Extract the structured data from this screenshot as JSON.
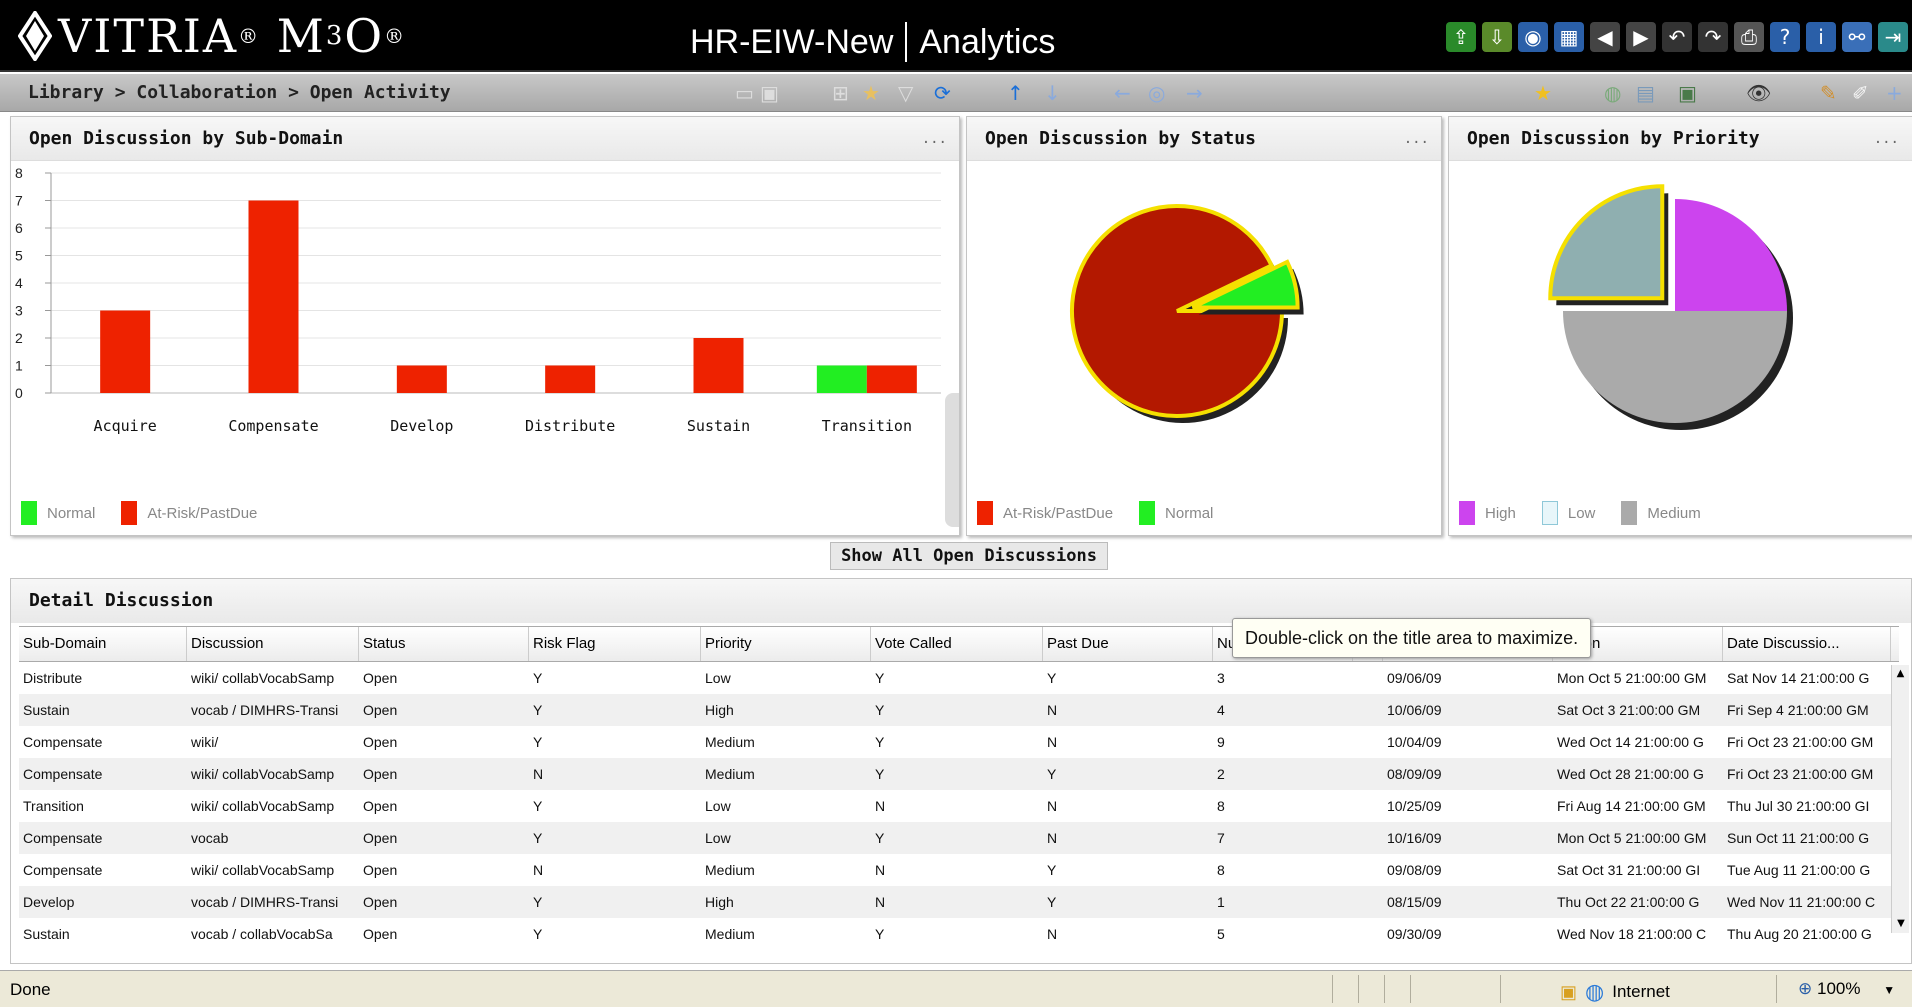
{
  "header": {
    "logo": "VITRIA",
    "logo_sup1": "®",
    "product": "M",
    "product_sub": "3",
    "product_end": "O",
    "logo_sup2": "®",
    "app_name": "HR-EIW-New",
    "section": "Analytics"
  },
  "breadcrumb": "Library > Collaboration > Open Activity",
  "subdomain_panel": {
    "title": "Open Discussion by Sub-Domain",
    "menu": "...",
    "legend": [
      "Normal",
      "At-Risk/PastDue"
    ]
  },
  "status_panel": {
    "title": "Open Discussion by Status",
    "menu": "...",
    "legend": [
      "At-Risk/PastDue",
      "Normal"
    ]
  },
  "priority_panel": {
    "title": "Open Discussion by Priority",
    "menu": "...",
    "legend": [
      "High",
      "Low",
      "Medium"
    ]
  },
  "show_all_label": "Show All Open Discussions",
  "detail": {
    "title": "Detail Discussion",
    "tooltip": "Double-click on the title area to maximize.",
    "columns": [
      "Sub-Domain",
      "Discussion",
      "Status",
      "Risk Flag",
      "Priority",
      "Vote Called",
      "Past Due",
      "Nu",
      "",
      "",
      "ussion",
      "Date Discussio..."
    ],
    "rows": [
      [
        "Distribute",
        "wiki/ collabVocabSamp",
        "Open",
        "Y",
        "Low",
        "Y",
        "Y",
        "3",
        "",
        "09/06/09",
        "Mon Oct 5 21:00:00 GM",
        "Sat Nov 14 21:00:00 G"
      ],
      [
        "Sustain",
        "vocab / DIMHRS-Transi",
        "Open",
        "Y",
        "High",
        "Y",
        "N",
        "4",
        "",
        "10/06/09",
        "Sat Oct 3 21:00:00 GM",
        "Fri Sep 4 21:00:00 GM"
      ],
      [
        "Compensate",
        "wiki/",
        "Open",
        "Y",
        "Medium",
        "Y",
        "N",
        "9",
        "",
        "10/04/09",
        "Wed Oct 14 21:00:00 G",
        "Fri Oct 23 21:00:00 GM"
      ],
      [
        "Compensate",
        "wiki/ collabVocabSamp",
        "Open",
        "N",
        "Medium",
        "Y",
        "Y",
        "2",
        "",
        "08/09/09",
        "Wed Oct 28 21:00:00 G",
        "Fri Oct 23 21:00:00 GM"
      ],
      [
        "Transition",
        "wiki/ collabVocabSamp",
        "Open",
        "Y",
        "Low",
        "N",
        "N",
        "8",
        "",
        "10/25/09",
        "Fri Aug 14 21:00:00 GM",
        "Thu Jul 30 21:00:00 GI"
      ],
      [
        "Compensate",
        "vocab",
        "Open",
        "Y",
        "Low",
        "Y",
        "N",
        "7",
        "",
        "10/16/09",
        "Mon Oct 5 21:00:00 GM",
        "Sun Oct 11 21:00:00 G"
      ],
      [
        "Compensate",
        "wiki/ collabVocabSamp",
        "Open",
        "N",
        "Medium",
        "N",
        "Y",
        "8",
        "",
        "09/08/09",
        "Sat Oct 31 21:00:00 GI",
        "Tue Aug 11 21:00:00 G"
      ],
      [
        "Develop",
        "vocab / DIMHRS-Transi",
        "Open",
        "Y",
        "High",
        "N",
        "Y",
        "1",
        "",
        "08/15/09",
        "Thu Oct 22 21:00:00 G",
        "Wed Nov 11 21:00:00 C"
      ],
      [
        "Sustain",
        "vocab / collabVocabSa",
        "Open",
        "Y",
        "Medium",
        "Y",
        "N",
        "5",
        "",
        "09/30/09",
        "Wed Nov 18 21:00:00 C",
        "Thu Aug 20 21:00:00 G"
      ]
    ]
  },
  "statusbar": {
    "status": "Done",
    "zone": "Internet",
    "zoom": "100%"
  },
  "colors": {
    "normal": "#22ee22",
    "at_risk": "#ee2200",
    "pie_red": "#b31800",
    "high": "#cc44ee",
    "low": "#8fafb0",
    "medium": "#aaaaaa"
  },
  "chart_data": [
    {
      "type": "bar",
      "categories": [
        "Acquire",
        "Compensate",
        "Develop",
        "Distribute",
        "Sustain",
        "Transition"
      ],
      "series": [
        {
          "name": "Normal",
          "values": [
            0,
            0,
            0,
            0,
            0,
            1
          ]
        },
        {
          "name": "At-Risk/PastDue",
          "values": [
            3,
            7,
            1,
            1,
            2,
            1
          ]
        }
      ],
      "ylim": [
        0,
        8
      ],
      "yticks": [
        0,
        1,
        2,
        3,
        4,
        5,
        6,
        7,
        8
      ],
      "legend": "bottom-left"
    },
    {
      "type": "pie",
      "labels": [
        "At-Risk/PastDue",
        "Normal"
      ],
      "values": [
        13,
        1
      ],
      "legend": "bottom-left"
    },
    {
      "type": "pie",
      "labels": [
        "High",
        "Low",
        "Medium"
      ],
      "values": [
        2,
        2,
        4
      ],
      "legend": "bottom-left"
    }
  ]
}
